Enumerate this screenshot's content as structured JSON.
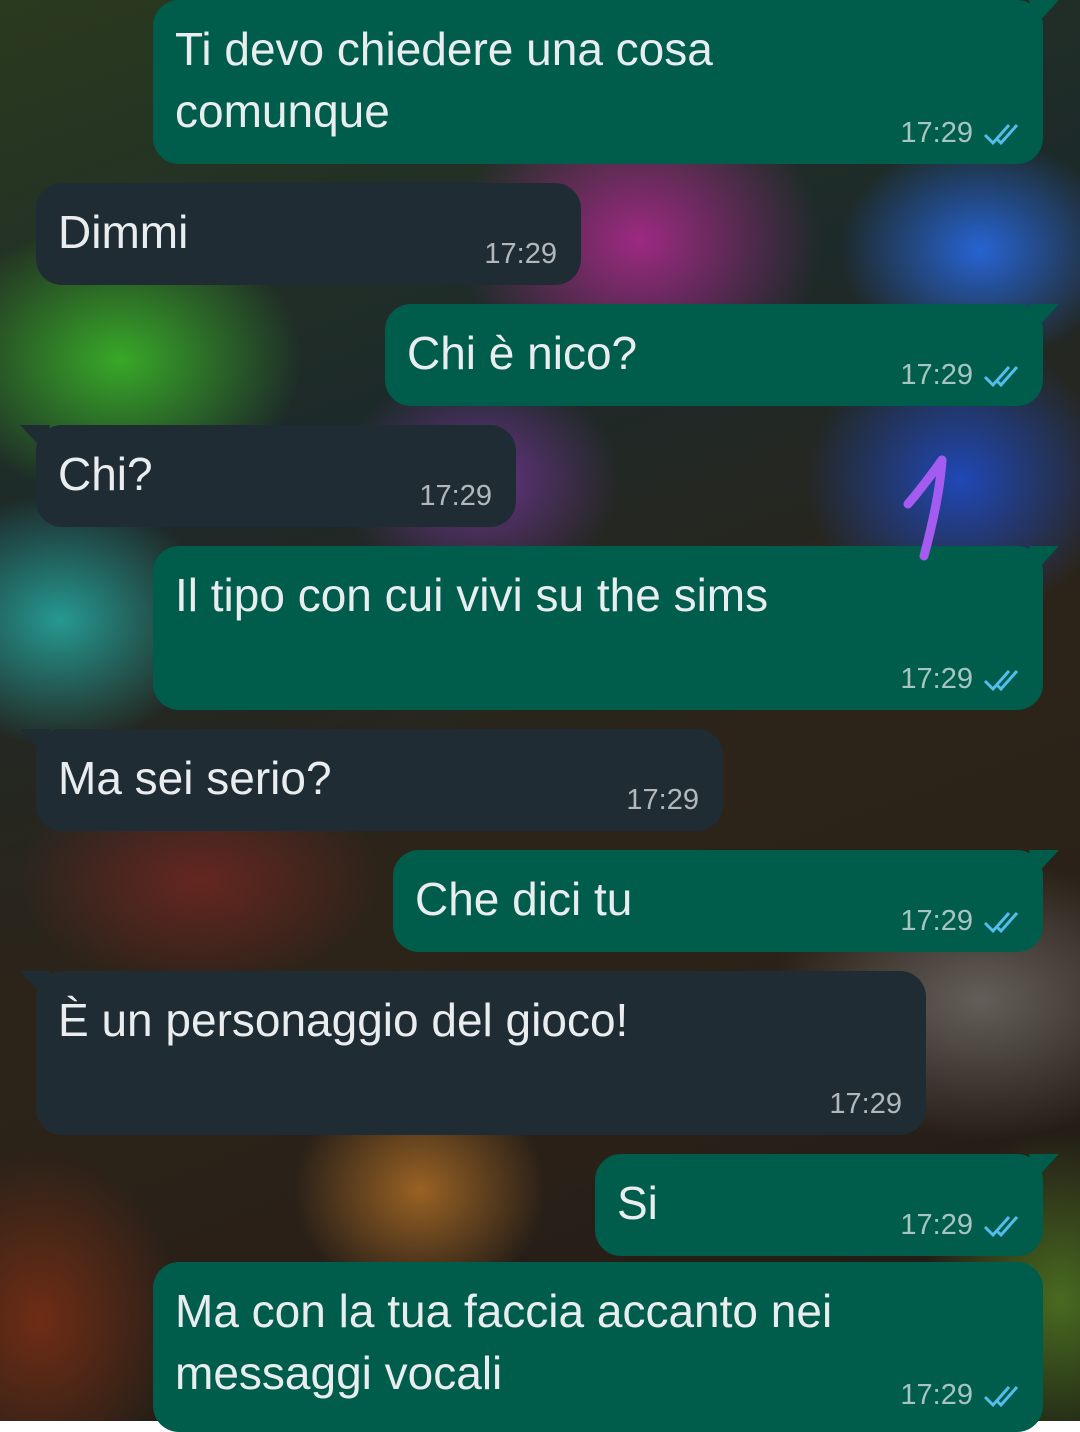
{
  "colors": {
    "outgoing_bubble": "#005c4b",
    "incoming_bubble": "#202c33",
    "read_ticks": "#53bdeb",
    "doodle": "#a45cf0"
  },
  "messages": [
    {
      "direction": "out",
      "text": "Ti devo chiedere una cosa\ncomunque",
      "time": "17:29",
      "status": "read"
    },
    {
      "direction": "in",
      "text": "Dimmi",
      "time": "17:29"
    },
    {
      "direction": "out",
      "text": "Chi è nico?",
      "time": "17:29",
      "status": "read"
    },
    {
      "direction": "in",
      "text": "Chi?",
      "time": "17:29"
    },
    {
      "direction": "out",
      "text": "Il tipo con cui vivi su the sims",
      "time": "17:29",
      "status": "read"
    },
    {
      "direction": "in",
      "text": "Ma sei serio?",
      "time": "17:29"
    },
    {
      "direction": "out",
      "text": "Che dici tu",
      "time": "17:29",
      "status": "read"
    },
    {
      "direction": "in",
      "text": "È un personaggio del gioco!",
      "time": "17:29"
    },
    {
      "direction": "out",
      "text": "Si",
      "time": "17:29",
      "status": "read"
    },
    {
      "direction": "out",
      "text": "Ma con la tua faccia accanto nei\nmessaggi vocali",
      "time": "17:29",
      "status": "read"
    }
  ],
  "doodle_icon": "hand-drawn-number-one-icon"
}
